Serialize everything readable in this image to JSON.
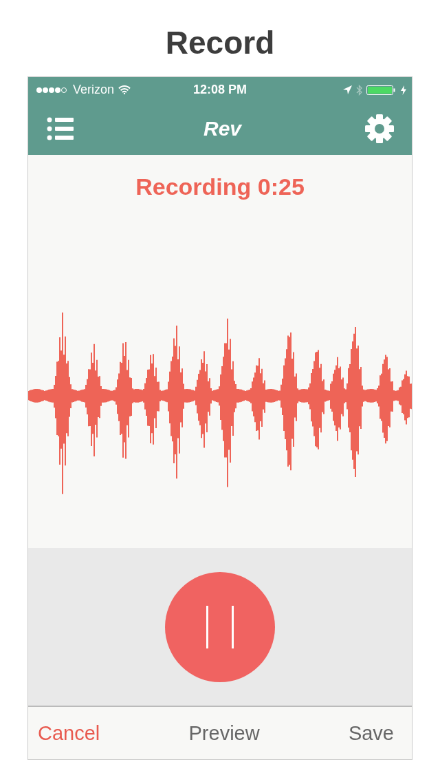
{
  "page_title": "Record",
  "status_bar": {
    "carrier": "Verizon",
    "time": "12:08 PM"
  },
  "nav_bar": {
    "logo": "Rev"
  },
  "recording": {
    "label": "Recording 0:25"
  },
  "bottom_bar": [
    {
      "label": "Cancel",
      "kind": "destructive"
    },
    {
      "label": "Preview",
      "kind": "plain"
    },
    {
      "label": "Save",
      "kind": "plain"
    }
  ]
}
